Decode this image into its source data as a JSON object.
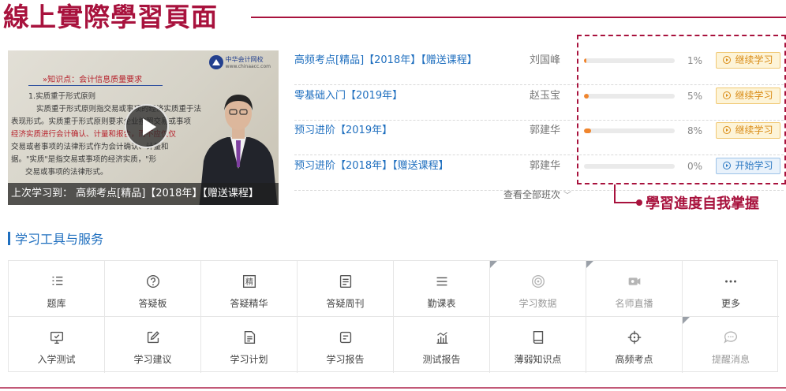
{
  "header": {
    "title": "線上實際學習頁面"
  },
  "video": {
    "logo_name": "中华会计网校",
    "logo_url": "www.chinaacc.com",
    "knowledge_point": "»知识点：会计信息质量要求",
    "lines": [
      "1.实质重于形式原则",
      "实质重于形式原则指交易或事项的经济实质重于法",
      "表现形式。实质重于形式原则要求企业按照交易或事项",
      "经济实质进行会计确认、计量和报告，而不应仅仅",
      "交易或者事项的法律形式作为会计确认、计量和",
      "据。\"实质\"是指交易或事项的经济实质，\"形",
      "交易或事项的法律形式。"
    ],
    "caption": "上次学习到： 高频考点[精品]【2018年】【赠送课程】"
  },
  "courses": [
    {
      "name": "高频考点[精品]【2018年】【赠送课程】",
      "teacher": "刘国峰",
      "progress": 1,
      "progress_label": "1%",
      "action": "继续学习",
      "action_type": "continue"
    },
    {
      "name": "零基础入门【2019年】",
      "teacher": "赵玉宝",
      "progress": 5,
      "progress_label": "5%",
      "action": "继续学习",
      "action_type": "continue"
    },
    {
      "name": "预习进阶【2019年】",
      "teacher": "郭建华",
      "progress": 8,
      "progress_label": "8%",
      "action": "继续学习",
      "action_type": "continue"
    },
    {
      "name": "预习进阶【2018年】【赠送课程】",
      "teacher": "郭建华",
      "progress": 0,
      "progress_label": "0%",
      "action": "开始学习",
      "action_type": "start"
    }
  ],
  "view_all": "查看全部班次",
  "annotation": {
    "text": "學習進度自我掌握",
    "color": "#a8123d"
  },
  "tools": {
    "title": "学习工具与服务",
    "items": [
      {
        "label": "题库",
        "icon": "list-icon",
        "dim": false,
        "corner": false
      },
      {
        "label": "答疑板",
        "icon": "question-circle-icon",
        "dim": false,
        "corner": false
      },
      {
        "label": "答疑精华",
        "icon": "jing-icon",
        "dim": false,
        "corner": false
      },
      {
        "label": "答疑周刊",
        "icon": "document-icon",
        "dim": false,
        "corner": false
      },
      {
        "label": "勤课表",
        "icon": "lines-icon",
        "dim": false,
        "corner": false
      },
      {
        "label": "学习数据",
        "icon": "target-icon",
        "dim": true,
        "corner": true
      },
      {
        "label": "名师直播",
        "icon": "video-camera-icon",
        "dim": true,
        "corner": true
      },
      {
        "label": "更多",
        "icon": "more-dots-icon",
        "dim": false,
        "corner": false
      },
      {
        "label": "入学测试",
        "icon": "monitor-icon",
        "dim": false,
        "corner": false
      },
      {
        "label": "学习建议",
        "icon": "edit-icon",
        "dim": false,
        "corner": false
      },
      {
        "label": "学习计划",
        "icon": "file-text-icon",
        "dim": false,
        "corner": false
      },
      {
        "label": "学习报告",
        "icon": "report-icon",
        "dim": false,
        "corner": false
      },
      {
        "label": "测试报告",
        "icon": "bar-chart-icon",
        "dim": false,
        "corner": false
      },
      {
        "label": "薄弱知识点",
        "icon": "book-icon",
        "dim": false,
        "corner": false
      },
      {
        "label": "高频考点",
        "icon": "crosshair-icon",
        "dim": false,
        "corner": false
      },
      {
        "label": "提醒消息",
        "icon": "chat-bubble-icon",
        "dim": true,
        "corner": true
      }
    ]
  },
  "colors": {
    "brand": "#a8123d",
    "link": "#1f6fbf",
    "progress": "#f0852d"
  }
}
